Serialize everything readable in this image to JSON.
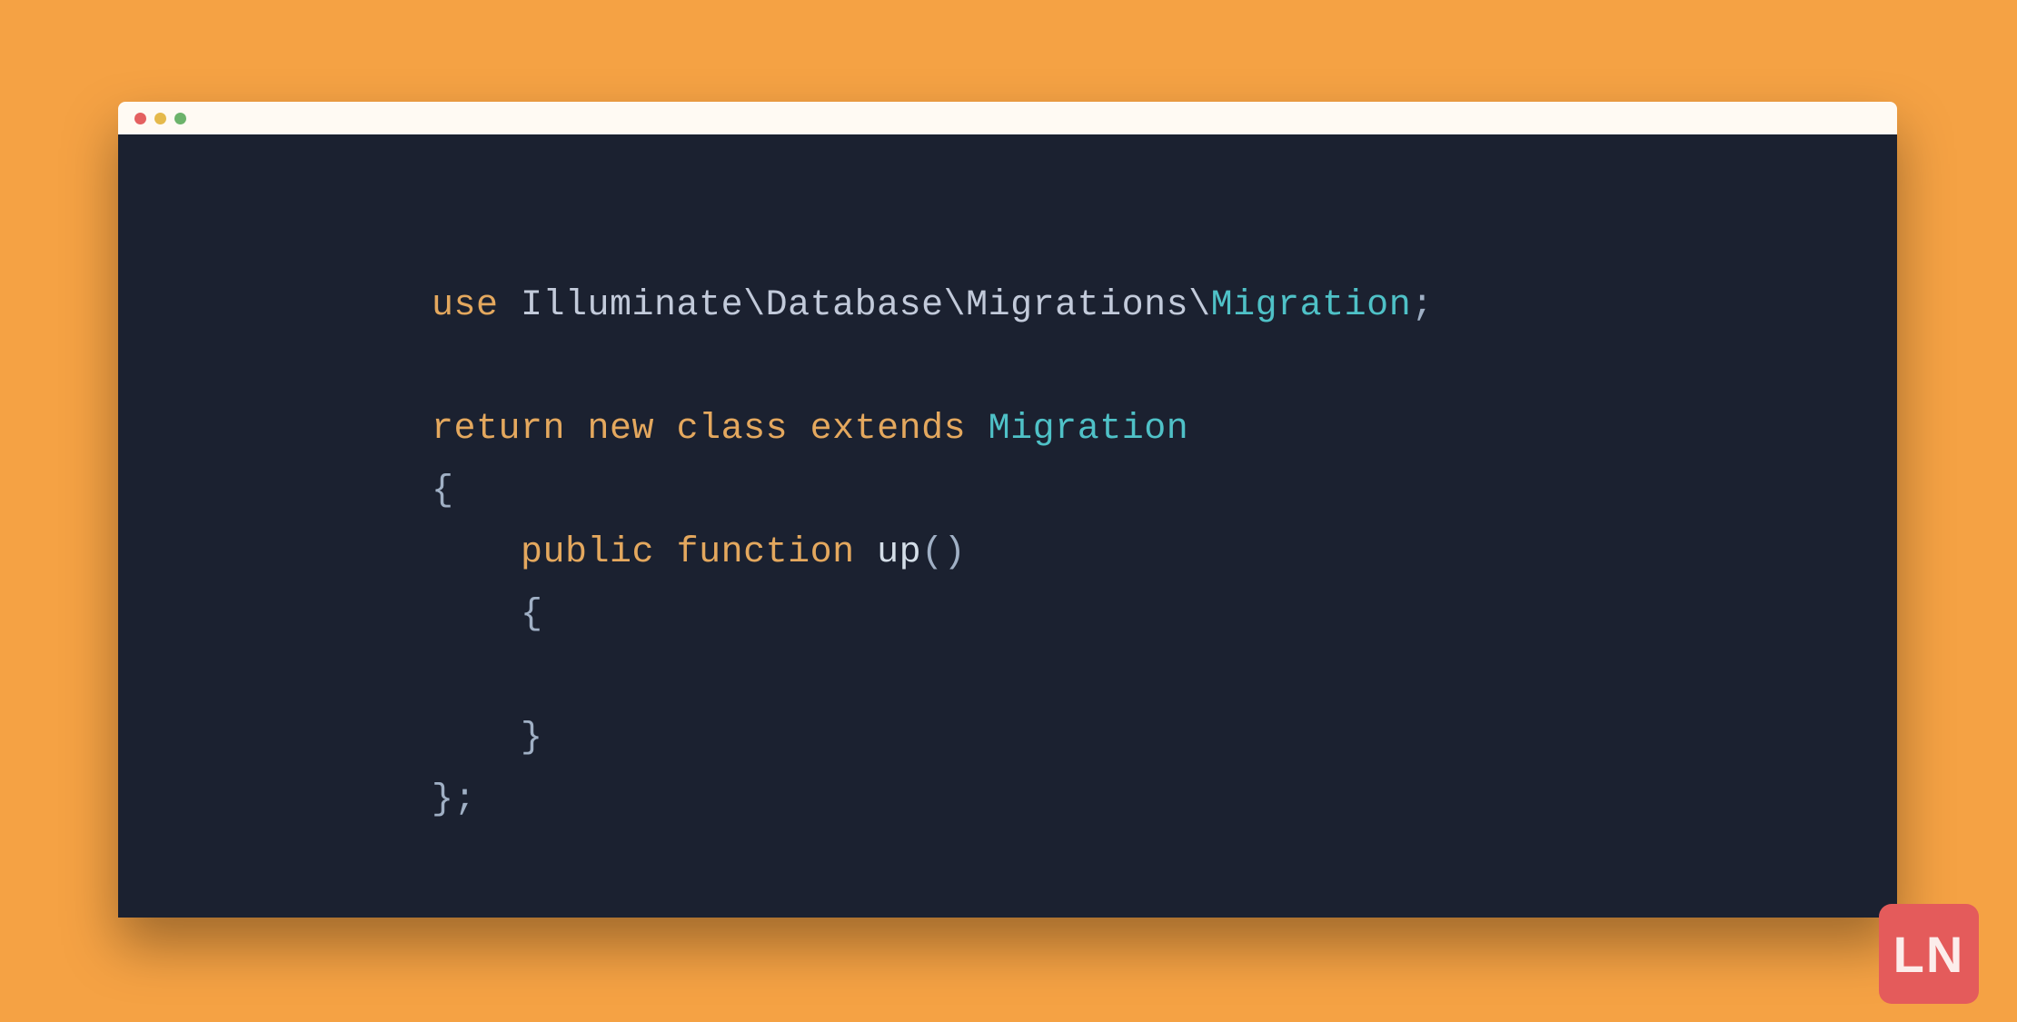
{
  "colors": {
    "page_bg": "#F5A244",
    "titlebar_bg": "#FFFAF3",
    "editor_bg": "#1B2130",
    "dot_red": "#E46060",
    "dot_yellow": "#E5B94B",
    "dot_green": "#6CB36B",
    "token_keyword": "#E4A85E",
    "token_identifier": "#C2CADA",
    "token_punct": "#A0B0C5",
    "token_type": "#4FC1C7",
    "token_function": "#D4DEE8",
    "logo_bg": "#E45B5B",
    "logo_fg": "#FCEDEB"
  },
  "code": {
    "tokens": {
      "kw_use": "use",
      "ns_path": "Illuminate\\Database\\Migrations\\",
      "type_migration": "Migration",
      "semi": ";",
      "kw_return": "return",
      "kw_new": "new",
      "kw_class": "class",
      "kw_extends": "extends",
      "kw_public": "public",
      "kw_function": "function",
      "fn_up": "up",
      "paren_open": "(",
      "paren_close": ")",
      "brace_open": "{",
      "brace_close": "}",
      "brace_close_semi": "};",
      "indent1": "    ",
      "indent2": "    "
    },
    "raw": "use Illuminate\\Database\\Migrations\\Migration;\n\nreturn new class extends Migration\n{\n    public function up()\n    {\n\n    }\n};"
  },
  "logo": {
    "text": "LN"
  }
}
